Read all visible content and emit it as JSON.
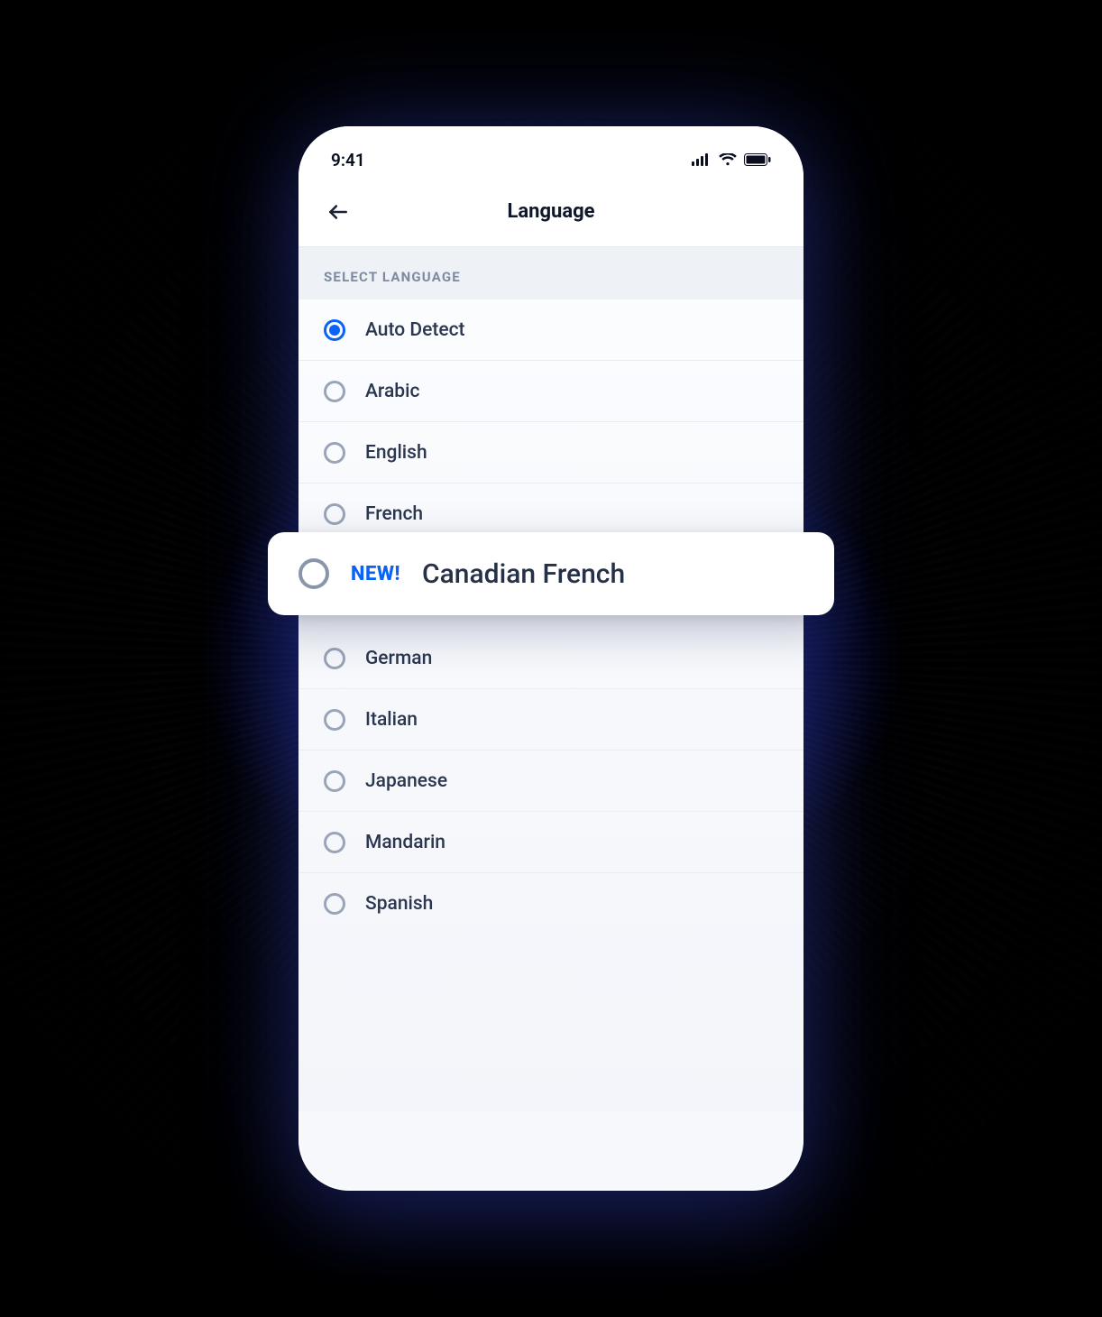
{
  "status_bar": {
    "time": "9:41"
  },
  "nav": {
    "title": "Language"
  },
  "section": {
    "header": "SELECT LANGUAGE"
  },
  "callout": {
    "badge": "NEW!",
    "label": "Canadian French"
  },
  "languages": [
    {
      "label": "Auto Detect",
      "selected": true
    },
    {
      "label": "Arabic",
      "selected": false
    },
    {
      "label": "English",
      "selected": false
    },
    {
      "label": "French",
      "selected": false
    },
    {
      "label": "German",
      "selected": false
    },
    {
      "label": "Italian",
      "selected": false
    },
    {
      "label": "Japanese",
      "selected": false
    },
    {
      "label": "Mandarin",
      "selected": false
    },
    {
      "label": "Spanish",
      "selected": false
    }
  ]
}
